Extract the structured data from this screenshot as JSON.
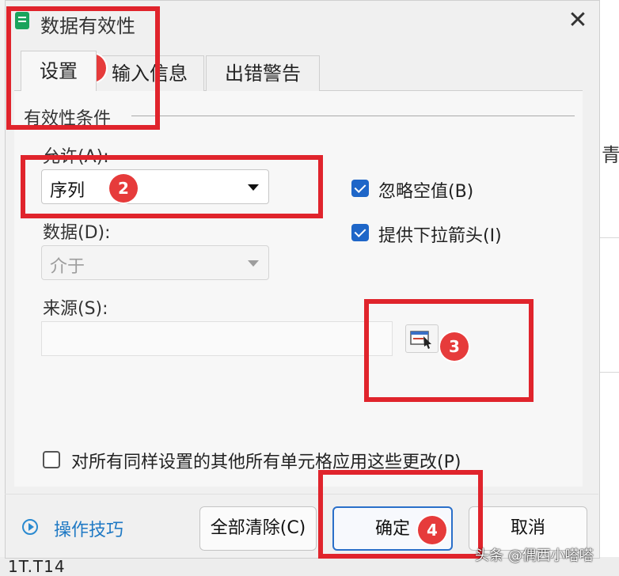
{
  "dialog": {
    "title": "数据有效性",
    "close_glyph": "✕"
  },
  "tabs": [
    {
      "label": "设置",
      "active": true
    },
    {
      "label": "输入信息",
      "active": false
    },
    {
      "label": "出错警告",
      "active": false
    }
  ],
  "validation": {
    "group_title": "有效性条件",
    "allow_label": "允许(A):",
    "allow_value": "序列",
    "data_label": "数据(D):",
    "data_value": "介于",
    "source_label": "来源(S):",
    "source_value": "",
    "ignore_blank_label": "忽略空值(B)",
    "ignore_blank_checked": true,
    "dropdown_label": "提供下拉箭头(I)",
    "dropdown_checked": true
  },
  "apply_all": {
    "label": "对所有同样设置的其他所有单元格应用这些更改(P)",
    "checked": false
  },
  "footer": {
    "tips_label": "操作技巧",
    "clear_label": "全部清除(C)",
    "ok_label": "确定",
    "cancel_label": "取消"
  },
  "annotations": {
    "badge_1": "1",
    "badge_2": "2",
    "badge_3": "3",
    "badge_4": "4"
  },
  "background": {
    "edge_char": "青",
    "bottom_text": "1T.T14"
  },
  "watermark": "头条 @偶西小嗒嗒",
  "colors": {
    "highlight": "#e0242c",
    "badge": "#e63b3b",
    "checkbox": "#1e66c8",
    "link": "#1f79c4",
    "primary_border": "#2a6fc9"
  }
}
